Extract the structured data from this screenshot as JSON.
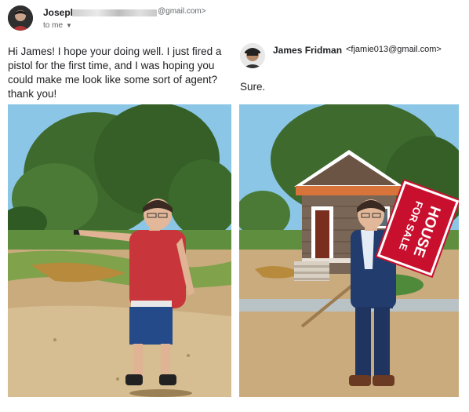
{
  "left_email": {
    "sender_name": "Joseph",
    "sender_email_suffix": "@gmail.com>",
    "recipient": "to me",
    "message": "Hi James! I hope your doing well. I just fired a pistol for the first time, and I was hoping you could make me look like some sort of agent? thank you!"
  },
  "right_email": {
    "sender_name": "James Fridman",
    "sender_email": "<fjamie013@gmail.com>",
    "message": "Sure."
  },
  "sign": {
    "line1": "HOUSE",
    "line2": "FOR SALE"
  },
  "colors": {
    "sign_red": "#c8102e",
    "shirt_red": "#c8363c",
    "sky": "#8cc6e6"
  }
}
